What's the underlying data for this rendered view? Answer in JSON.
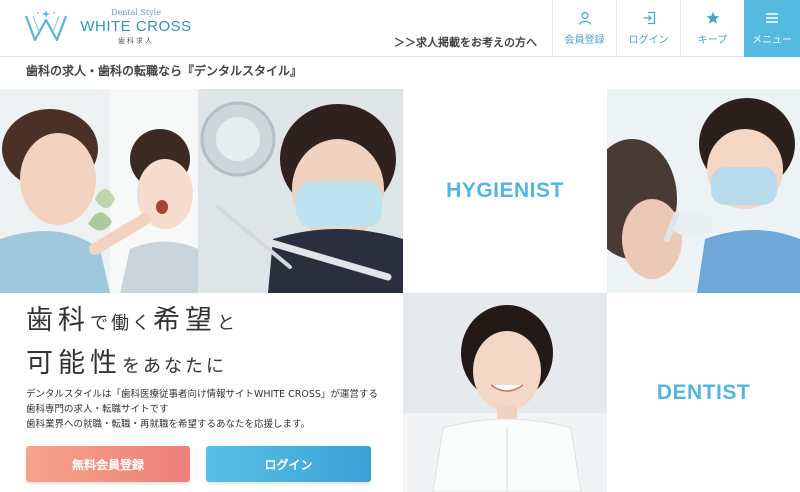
{
  "logo": {
    "style_text": "Dental Style",
    "name": "WHITE CROSS",
    "sub": "歯科求人"
  },
  "header": {
    "recruit_link": "＞＞求人掲載をお考えの方へ",
    "nav": [
      {
        "label": "会員登録",
        "icon": "person-icon"
      },
      {
        "label": "ログイン",
        "icon": "login-icon"
      },
      {
        "label": "キープ",
        "icon": "star-icon"
      },
      {
        "label": "メニュー",
        "icon": "menu-icon"
      }
    ]
  },
  "tagline": "歯科の求人・歯科の転職なら『デンタルスタイル』",
  "categories": {
    "hygienist": "HYGIENIST",
    "dentist": "DENTIST"
  },
  "hero": {
    "line1": [
      {
        "text": "歯科",
        "size": "big"
      },
      {
        "text": "で働く",
        "size": "small"
      },
      {
        "text": "希望",
        "size": "big"
      },
      {
        "text": "と",
        "size": "small"
      }
    ],
    "line2": [
      {
        "text": "可能性",
        "size": "big"
      },
      {
        "text": "をあなたに",
        "size": "small"
      }
    ],
    "description": [
      "デンタルスタイルは「歯科医療従事者向け情報サイトWHITE CROSS」が運営する",
      "歯科専門の求人・転職サイトです",
      "歯科業界への就職・転職・再就職を希望するあなたを応援します。"
    ],
    "register_button": "無料会員登録",
    "login_button": "ログイン"
  },
  "colors": {
    "accent": "#55b9e1",
    "register_gradient_start": "#f6a38a",
    "register_gradient_end": "#ee7f7a",
    "login_gradient_start": "#57c0e6",
    "login_gradient_end": "#3ca1d6"
  }
}
